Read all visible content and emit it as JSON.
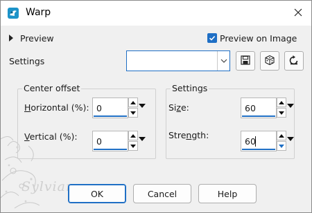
{
  "window": {
    "title": "Warp",
    "app_icon": "warp-app-icon",
    "close_icon": "close-icon"
  },
  "preview": {
    "toggle_label": "Preview",
    "preview_on_image_label": "Preview on Image",
    "preview_on_image_checked": true
  },
  "settings_bar": {
    "label": "Settings",
    "preset_value": "",
    "icons": [
      "save-icon",
      "randomize-icon",
      "reset-icon"
    ]
  },
  "center_offset": {
    "title": "Center offset",
    "horizontal": {
      "label_prefix": "H",
      "label_rest": "orizontal (%):",
      "value": "0"
    },
    "vertical": {
      "label_prefix": "V",
      "label_rest": "ertical (%):",
      "value": "0"
    }
  },
  "settings_group": {
    "title": "Settings",
    "size": {
      "label_pre": "Si",
      "label_u": "z",
      "label_post": "e:",
      "value": "60"
    },
    "strength": {
      "label_pre": "Stre",
      "label_u": "n",
      "label_post": "gth:",
      "value": "60"
    }
  },
  "watermark": {
    "text": "Sylviane"
  },
  "buttons": {
    "ok": "OK",
    "cancel": "Cancel",
    "help": "Help"
  },
  "colors": {
    "accent": "#1f6fc5",
    "background": "#f0f0f0",
    "titlebar": "#ffffff"
  }
}
